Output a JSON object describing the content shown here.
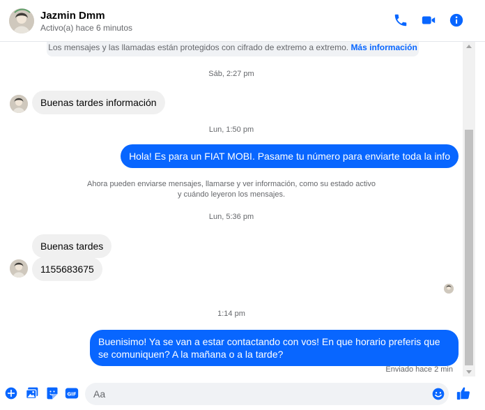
{
  "header": {
    "contact_name": "Jazmin Dmm",
    "status": "Activo(a) hace 6 minutos",
    "accent_color": "#0866ff"
  },
  "notice": {
    "text": "Los mensajes y las llamadas están protegidos con cifrado de extremo a extremo.",
    "link": "Más información"
  },
  "messages": {
    "ts1": "Sáb, 2:27 pm",
    "in1": "Buenas tardes información",
    "ts2": "Lun, 1:50 pm",
    "out1": "Hola! Es para un FIAT MOBI. Pasame tu número para enviarte toda la info",
    "system_line1": "Ahora pueden enviarse mensajes, llamarse y ver información, como su estado activo",
    "system_line2": "y cuándo leyeron los mensajes.",
    "ts3": "Lun, 5:36 pm",
    "in2": "Buenas tardes",
    "in3": "1155683675",
    "ts4": "1:14 pm",
    "out2": "Buenisimo! Ya se van a estar contactando con vos! En que horario preferis que se comuniquen? A la mañana o a la tarde?",
    "sent_status": "Enviado hace 2 min"
  },
  "composer": {
    "placeholder": "Aa"
  }
}
